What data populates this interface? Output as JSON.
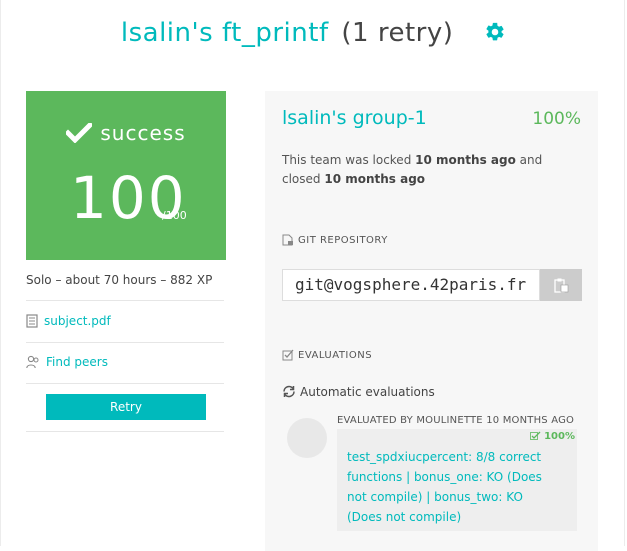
{
  "header": {
    "project_title": "lsalin's ft_printf",
    "retry_text": "(1 retry)",
    "settings_icon": "gear-icon"
  },
  "result": {
    "status": "success",
    "score": "100",
    "max_score": "/100",
    "status_icon": "check-icon",
    "color": "#5cb85c"
  },
  "project_meta": {
    "summary": "Solo – about 70 hours – 882 XP"
  },
  "links": {
    "subject": "subject.pdf",
    "find_peers": "Find peers",
    "retry": "Retry"
  },
  "team": {
    "name": "lsalin's group-1",
    "percent": "100%",
    "locked_prefix": "This team was locked ",
    "locked_time": "10 months ago",
    "closed_prefix": " and closed ",
    "closed_time": "10 months ago",
    "git_label": "GIT REPOSITORY",
    "git_url": "git@vogsphere.42paris.fr",
    "evaluations_label": "EVALUATIONS",
    "automatic_label": "Automatic evaluations",
    "evaluation": {
      "header": "EVALUATED BY MOULINETTE 10 MONTHS AGO",
      "percent": "100%",
      "comment": "test_spdxiucpercent: 8/8 correct functions | bonus_one: KO (Does not compile) | bonus_two: KO (Does not compile)"
    }
  },
  "colors": {
    "accent": "#00babc",
    "success": "#5cb85c"
  }
}
